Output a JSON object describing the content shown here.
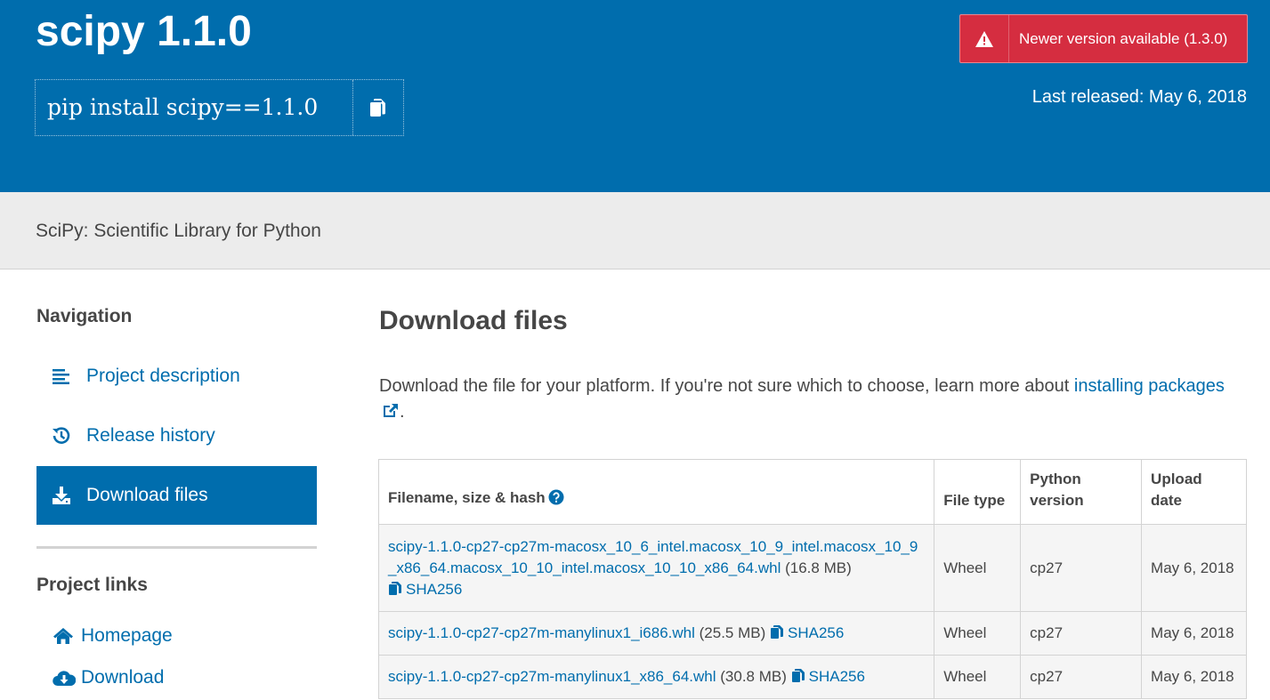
{
  "header": {
    "title": "scipy 1.1.0",
    "pip_command": "pip install scipy==1.1.0",
    "newer_version_label": "Newer version available (1.3.0)",
    "last_released": "Last released: May 6, 2018"
  },
  "summary": "SciPy: Scientific Library for Python",
  "sidebar": {
    "navigation_heading": "Navigation",
    "nav_items": [
      {
        "label": "Project description",
        "icon": "align-left-icon"
      },
      {
        "label": "Release history",
        "icon": "history-icon"
      },
      {
        "label": "Download files",
        "icon": "download-icon",
        "active": true
      }
    ],
    "project_links_heading": "Project links",
    "project_links": [
      {
        "label": "Homepage",
        "icon": "home-icon"
      },
      {
        "label": "Download",
        "icon": "cloud-download-icon"
      }
    ]
  },
  "main": {
    "heading": "Download files",
    "intro_text": "Download the file for your platform. If you're not sure which to choose, learn more about ",
    "intro_link": "installing packages",
    "intro_end": ".",
    "table": {
      "headers": [
        "Filename, size & hash",
        "File type",
        "Python version",
        "Upload date"
      ],
      "rows": [
        {
          "filename": "scipy-1.1.0-cp27-cp27m-macosx_10_6_intel.macosx_10_9_intel.macosx_10_9_x86_64.macosx_10_10_intel.macosx_10_10_x86_64.whl",
          "size": "(16.8 MB)",
          "hash_label": "SHA256",
          "file_type": "Wheel",
          "python_version": "cp27",
          "upload_date": "May 6, 2018"
        },
        {
          "filename": "scipy-1.1.0-cp27-cp27m-manylinux1_i686.whl",
          "size": "(25.5 MB)",
          "hash_label": "SHA256",
          "file_type": "Wheel",
          "python_version": "cp27",
          "upload_date": "May 6, 2018"
        },
        {
          "filename": "scipy-1.1.0-cp27-cp27m-manylinux1_x86_64.whl",
          "size": "(30.8 MB)",
          "hash_label": "SHA256",
          "file_type": "Wheel",
          "python_version": "cp27",
          "upload_date": "May 6, 2018"
        }
      ]
    }
  },
  "colors": {
    "brand_blue": "#006dad",
    "alert_red": "#d52d40",
    "summary_band": "#ececec"
  }
}
